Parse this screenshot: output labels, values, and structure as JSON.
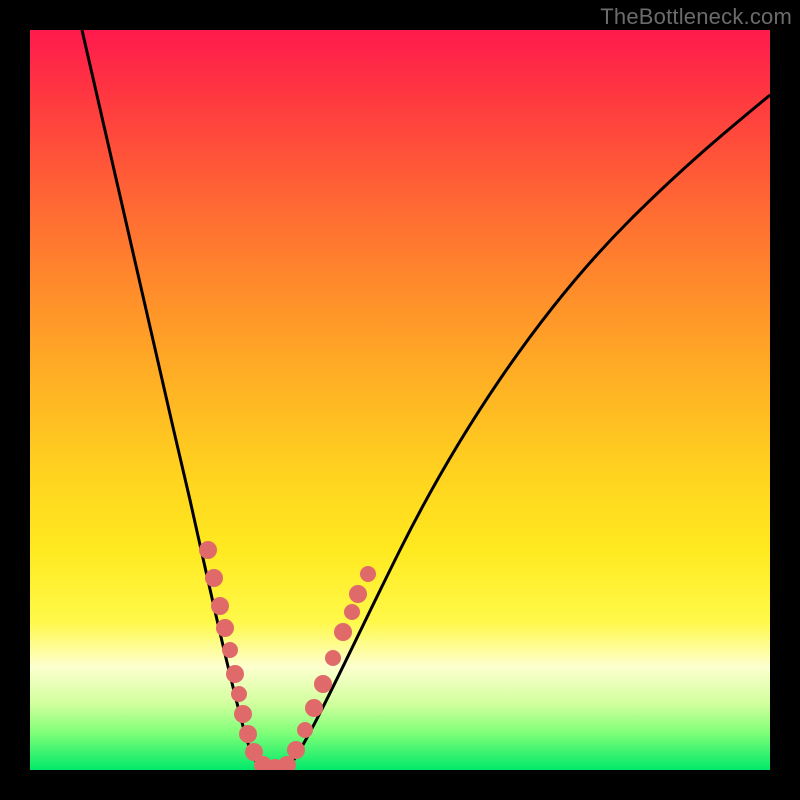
{
  "watermark": "TheBottleneck.com",
  "chart_data": {
    "type": "line",
    "title": "",
    "xlabel": "",
    "ylabel": "",
    "xlim": [
      0,
      100
    ],
    "ylim": [
      0,
      100
    ],
    "grid": false,
    "legend": false,
    "curve_note": "V-shaped bottleneck curve; y is bottleneck %, minimum near x≈30",
    "series": [
      {
        "name": "bottleneck-curve",
        "x": [
          7,
          9,
          12,
          15,
          18,
          21,
          24,
          26,
          28,
          30,
          32,
          34,
          36,
          38,
          41,
          45,
          50,
          56,
          63,
          71,
          80,
          90,
          100
        ],
        "y": [
          100,
          88,
          74,
          61,
          48,
          36,
          24,
          14,
          6,
          1,
          2,
          8,
          16,
          24,
          34,
          44,
          54,
          62,
          70,
          77,
          83,
          88,
          92
        ]
      }
    ],
    "scatter_points": {
      "name": "sample-dots",
      "color": "#e06a6a",
      "x": [
        22,
        23,
        24,
        24.5,
        25.5,
        26,
        26.5,
        27,
        28,
        29,
        30,
        31,
        32,
        33,
        34,
        35,
        36,
        37,
        38,
        39
      ],
      "y": [
        30,
        26,
        22,
        20,
        16,
        13,
        11,
        9,
        5,
        2,
        1,
        2,
        5,
        9,
        13,
        17,
        22,
        26,
        29,
        32
      ]
    }
  }
}
